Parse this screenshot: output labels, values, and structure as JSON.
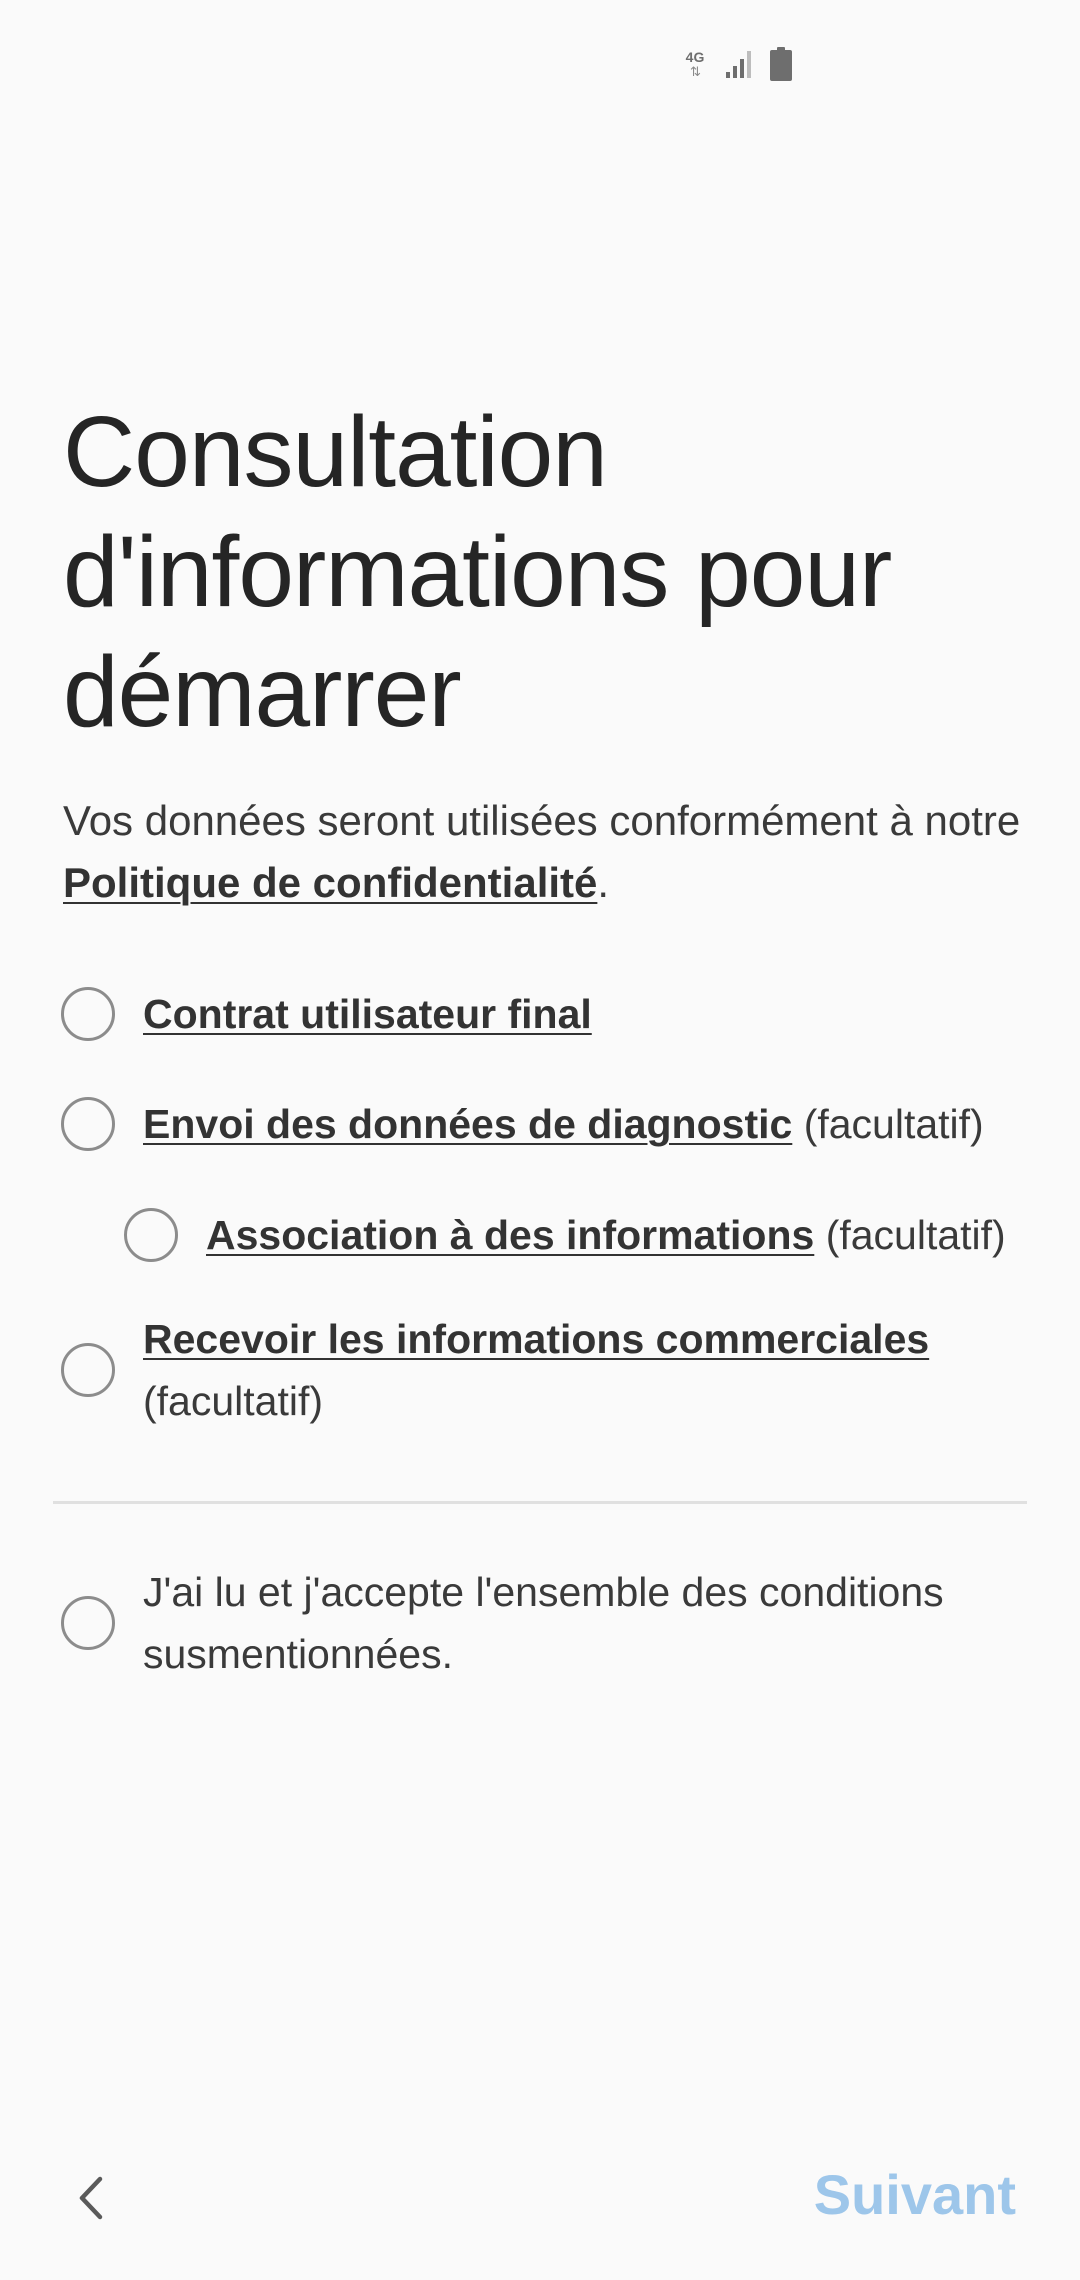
{
  "status_bar": {
    "network_label": "4G",
    "network_arrows": "⇅",
    "signal_icon": "signal-icon",
    "battery_icon": "battery-icon"
  },
  "title": "Consultation d'informations pour démarrer",
  "description": {
    "text_before": "Vos données seront utilisées conformément à notre ",
    "privacy_link": "Politique de confidentialité",
    "text_after": "."
  },
  "options": [
    {
      "link": "Contrat utilisateur final",
      "suffix": "",
      "checked": false
    },
    {
      "link": "Envoi des données de diagnostic",
      "suffix": " (facultatif)",
      "checked": false
    },
    {
      "link": "Association à des informations",
      "suffix": " (facultatif)",
      "checked": false
    },
    {
      "link": "Recevoir les informations commerciales",
      "suffix": "(facultatif)",
      "checked": false
    }
  ],
  "accept_all": {
    "text": "J'ai lu et j'accepte l'ensemble des conditions susmentionnées.",
    "checked": false
  },
  "navigation": {
    "back_icon": "chevron-left-icon",
    "next_label": "Suivant",
    "next_color": "#9dc6ea"
  }
}
